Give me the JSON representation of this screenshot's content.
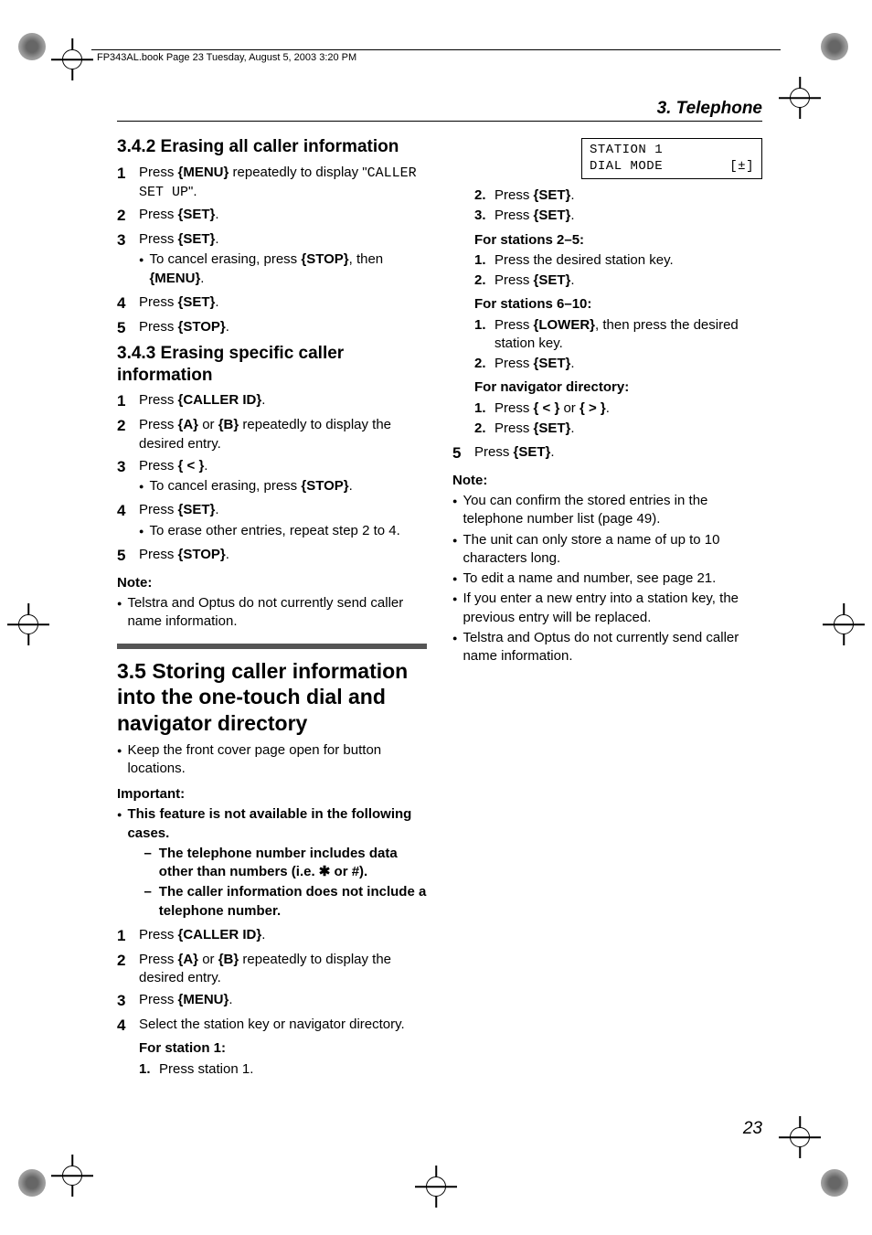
{
  "header": "FP343AL.book  Page 23  Tuesday, August 5, 2003  3:20 PM",
  "chapter": "3. Telephone",
  "page_number": "23",
  "keys": {
    "menu": "{MENU}",
    "set": "{SET}",
    "stop": "{STOP}",
    "caller_id": "{CALLER ID}",
    "plus": "{A}",
    "minus": "{B}",
    "left": "{ < }",
    "right": "{ > }",
    "lower": "{LOWER}"
  },
  "s342": {
    "title": "3.4.2 Erasing all caller information",
    "step1a": "Press ",
    "step1b": " repeatedly to display \"",
    "step1_code": "CALLER SET UP",
    "step1c": "\".",
    "step2": "Press ",
    "step3": "Press ",
    "step3_sub": "To cancel erasing, press ",
    "step3_sub2": ", then ",
    "step4": "Press ",
    "step5": "Press "
  },
  "s343": {
    "title": "3.4.3 Erasing specific caller information",
    "step1": "Press ",
    "step2a": "Press ",
    "step2b": " or ",
    "step2c": " repeatedly to display the desired entry.",
    "step3": "Press ",
    "step3_sub": "To cancel erasing, press ",
    "step4": "Press ",
    "step4_sub": "To erase other entries, repeat step 2 to 4.",
    "step5": "Press ",
    "note_head": "Note:",
    "note1": "Telstra and Optus do not currently send caller name information."
  },
  "s35": {
    "title": "3.5 Storing caller information into the one-touch dial and navigator directory",
    "intro": "Keep the front cover page open for button locations.",
    "important_head": "Important:",
    "important_lead": "This feature is not available in the following cases.",
    "imp_dash1": "The telephone number includes data other than numbers (i.e. ✱ or #).",
    "imp_dash2": "The caller information does not include a telephone number.",
    "step1": "Press ",
    "step2a": "Press ",
    "step2b": " or ",
    "step2c": " repeatedly to display the desired entry.",
    "step3": "Press ",
    "step4": "Select the station key or navigator directory.",
    "for_s1": "For station 1:",
    "s1_1": "Press station 1.",
    "lcd_line1": "STATION 1",
    "lcd_line2a": "DIAL MODE",
    "lcd_line2b": "[±]",
    "s1_2": "Press ",
    "s1_3": "Press ",
    "for_s25": "For stations 2–5:",
    "s25_1": "Press the desired station key.",
    "s25_2": "Press ",
    "for_s610": "For stations 6–10:",
    "s610_1a": "Press ",
    "s610_1b": ", then press the desired station key.",
    "s610_2": "Press ",
    "for_nav": "For navigator directory:",
    "nav_1a": "Press ",
    "nav_1b": " or ",
    "nav_2": "Press ",
    "step5": "Press ",
    "note_head": "Note:",
    "note1": "You can confirm the stored entries in the telephone number list (page 49).",
    "note2": "The unit can only store a name of up to 10 characters long.",
    "note3": "To edit a name and number, see page 21.",
    "note4": "If you enter a new entry into a station key, the previous entry will be replaced.",
    "note5": "Telstra and Optus do not currently send caller name information."
  }
}
